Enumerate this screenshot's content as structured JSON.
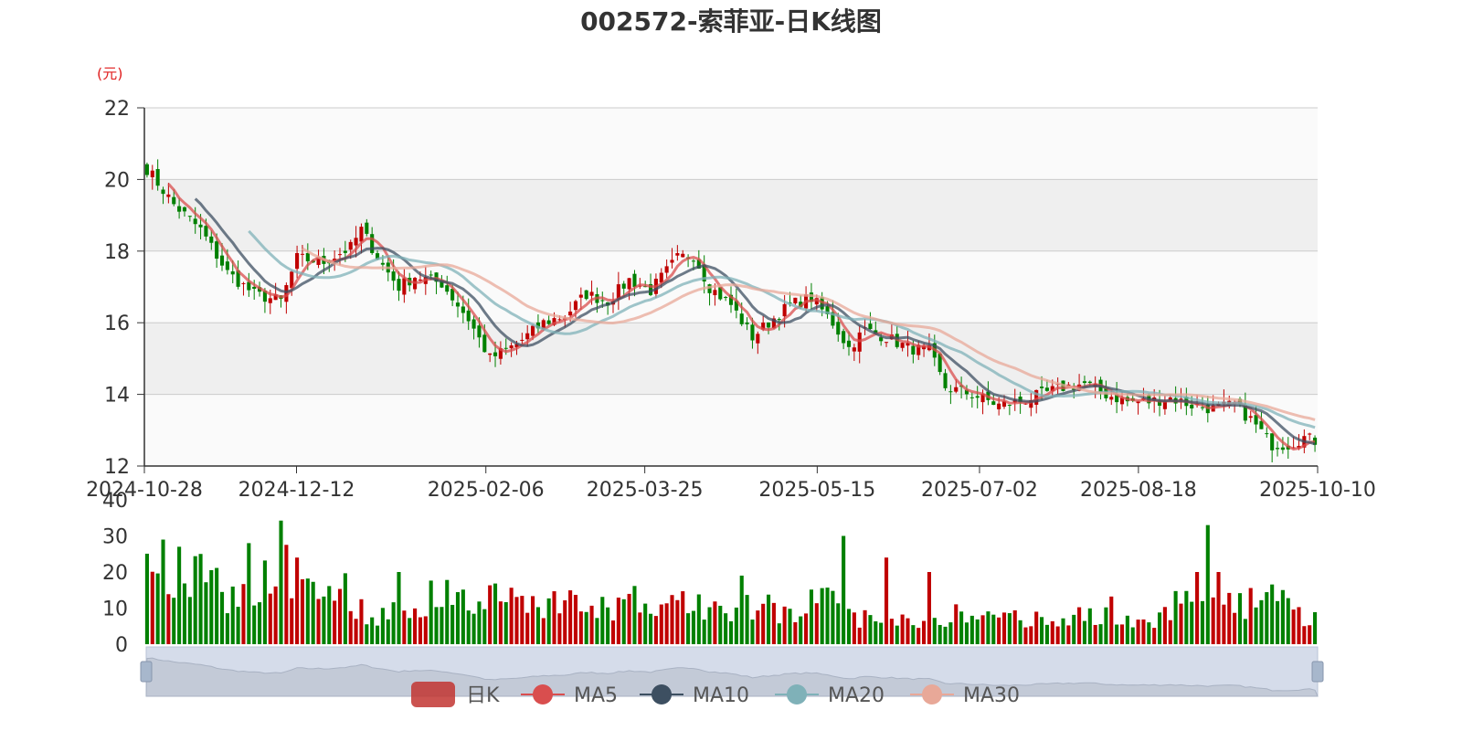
{
  "chart_data": {
    "type": "candlestick",
    "title": "002572-索菲亚-日K线图",
    "y_unit": "(元)",
    "price_axis": {
      "min": 12,
      "max": 22,
      "ticks": [
        "12",
        "14",
        "16",
        "18",
        "20",
        "22"
      ]
    },
    "volume_axis": {
      "min": 0,
      "max": 40,
      "ticks": [
        "0",
        "10",
        "20",
        "30",
        "40"
      ]
    },
    "x_ticks": [
      "2024-10-28",
      "2024-12-12",
      "2025-02-06",
      "2025-03-25",
      "2025-05-15",
      "2025-07-02",
      "2025-08-18",
      "2025-10-10"
    ],
    "x_range": [
      "2024-10-28",
      "2025-10-10"
    ],
    "grid_bands": true,
    "legend_position": "bottom-center",
    "colors": {
      "up": "#c00000",
      "down": "#008000",
      "ma5": "#d94e4e",
      "ma10": "#3d4f61",
      "ma20": "#7fb1b8",
      "ma30": "#e8a898",
      "band": "#efefef",
      "slider": "#d5dcea"
    },
    "legend": [
      {
        "key": "k",
        "label": "日K"
      },
      {
        "key": "ma5",
        "label": "MA5"
      },
      {
        "key": "ma10",
        "label": "MA10"
      },
      {
        "key": "ma20",
        "label": "MA20"
      },
      {
        "key": "ma30",
        "label": "MA30"
      }
    ],
    "close_anchors": [
      [
        0,
        20.3
      ],
      [
        5,
        19.3
      ],
      [
        10,
        18.6
      ],
      [
        15,
        17.4
      ],
      [
        20,
        16.8
      ],
      [
        25,
        16.6
      ],
      [
        28,
        17.8
      ],
      [
        33,
        17.7
      ],
      [
        38,
        18.1
      ],
      [
        40,
        18.6
      ],
      [
        44,
        17.6
      ],
      [
        47,
        17.0
      ],
      [
        50,
        17.3
      ],
      [
        55,
        17.1
      ],
      [
        60,
        16.1
      ],
      [
        64,
        15.0
      ],
      [
        69,
        15.4
      ],
      [
        74,
        16.0
      ],
      [
        78,
        16.2
      ],
      [
        82,
        16.8
      ],
      [
        86,
        16.6
      ],
      [
        90,
        17.2
      ],
      [
        94,
        16.9
      ],
      [
        99,
        17.8
      ],
      [
        102,
        17.9
      ],
      [
        105,
        17.0
      ],
      [
        109,
        16.5
      ],
      [
        113,
        15.6
      ],
      [
        116,
        16.0
      ],
      [
        120,
        16.5
      ],
      [
        124,
        16.7
      ],
      [
        128,
        16.0
      ],
      [
        131,
        15.3
      ],
      [
        134,
        15.8
      ],
      [
        138,
        15.6
      ],
      [
        142,
        15.3
      ],
      [
        146,
        15.2
      ],
      [
        149,
        14.2
      ],
      [
        154,
        14.0
      ],
      [
        159,
        13.7
      ],
      [
        163,
        13.8
      ],
      [
        167,
        14.0
      ],
      [
        171,
        14.2
      ],
      [
        175,
        14.3
      ],
      [
        179,
        14.0
      ],
      [
        183,
        13.8
      ],
      [
        187,
        13.8
      ],
      [
        191,
        13.9
      ],
      [
        195,
        13.7
      ],
      [
        199,
        13.6
      ],
      [
        203,
        13.7
      ],
      [
        206,
        13.3
      ],
      [
        210,
        12.6
      ],
      [
        213,
        12.6
      ],
      [
        216,
        12.8
      ],
      [
        218,
        12.7
      ]
    ],
    "volume_anchors": [
      [
        0,
        23
      ],
      [
        5,
        21
      ],
      [
        10,
        21
      ],
      [
        15,
        14
      ],
      [
        20,
        14
      ],
      [
        25,
        27
      ],
      [
        30,
        16
      ],
      [
        35,
        19
      ],
      [
        40,
        10
      ],
      [
        45,
        8
      ],
      [
        50,
        12
      ],
      [
        55,
        15
      ],
      [
        60,
        12
      ],
      [
        65,
        14
      ],
      [
        70,
        13
      ],
      [
        75,
        12
      ],
      [
        80,
        12
      ],
      [
        85,
        10
      ],
      [
        90,
        13
      ],
      [
        95,
        10
      ],
      [
        100,
        12
      ],
      [
        105,
        11
      ],
      [
        110,
        9
      ],
      [
        115,
        12
      ],
      [
        120,
        9
      ],
      [
        125,
        13
      ],
      [
        130,
        10
      ],
      [
        135,
        7
      ],
      [
        140,
        8
      ],
      [
        145,
        6
      ],
      [
        150,
        9
      ],
      [
        155,
        7
      ],
      [
        160,
        9
      ],
      [
        165,
        7
      ],
      [
        170,
        6
      ],
      [
        175,
        9
      ],
      [
        180,
        10
      ],
      [
        185,
        6
      ],
      [
        190,
        9
      ],
      [
        195,
        17
      ],
      [
        200,
        10
      ],
      [
        205,
        12
      ],
      [
        210,
        13
      ],
      [
        215,
        9
      ],
      [
        218,
        8
      ]
    ],
    "volume_spikes": [
      [
        6,
        27
      ],
      [
        19,
        28
      ],
      [
        28,
        24
      ],
      [
        47,
        20
      ],
      [
        111,
        19
      ],
      [
        130,
        30
      ],
      [
        138,
        24
      ],
      [
        146,
        20
      ],
      [
        196,
        20
      ],
      [
        198,
        33
      ],
      [
        200,
        20
      ],
      [
        212,
        15
      ]
    ]
  }
}
